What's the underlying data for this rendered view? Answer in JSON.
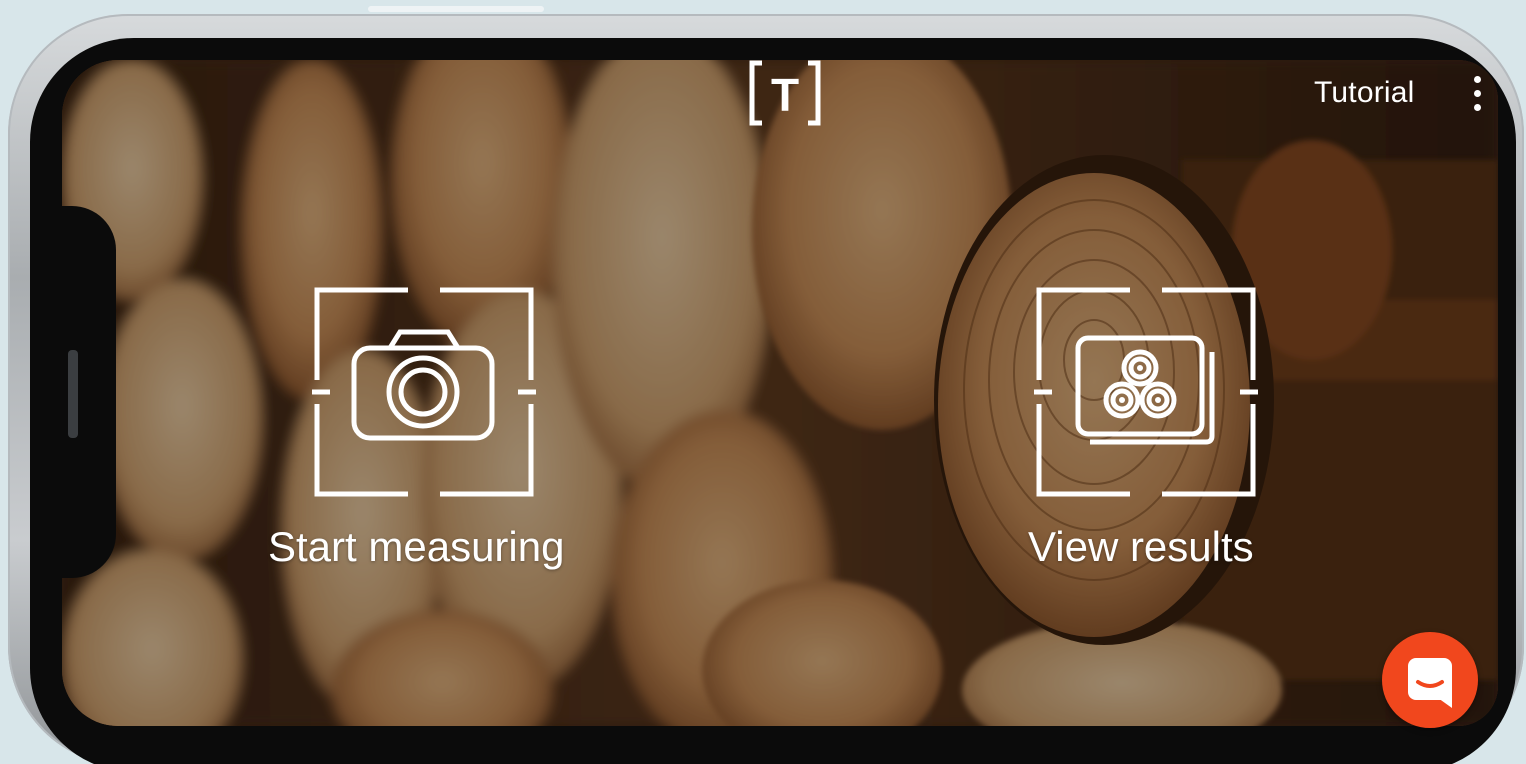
{
  "header": {
    "logo_letter": "T",
    "tutorial_label": "Tutorial"
  },
  "actions": {
    "start_measuring_label": "Start measuring",
    "view_results_label": "View results"
  },
  "icons": {
    "logo": "bracketed-t-logo",
    "menu": "more-vert-icon",
    "start": "camera-icon",
    "results": "stacked-logs-gallery-icon",
    "chat": "chat-bubble-icon"
  },
  "colors": {
    "fab_accent": "#f1471d",
    "text": "#ffffff",
    "wood_light": "#d9a36a",
    "wood_dark": "#5a3418"
  }
}
